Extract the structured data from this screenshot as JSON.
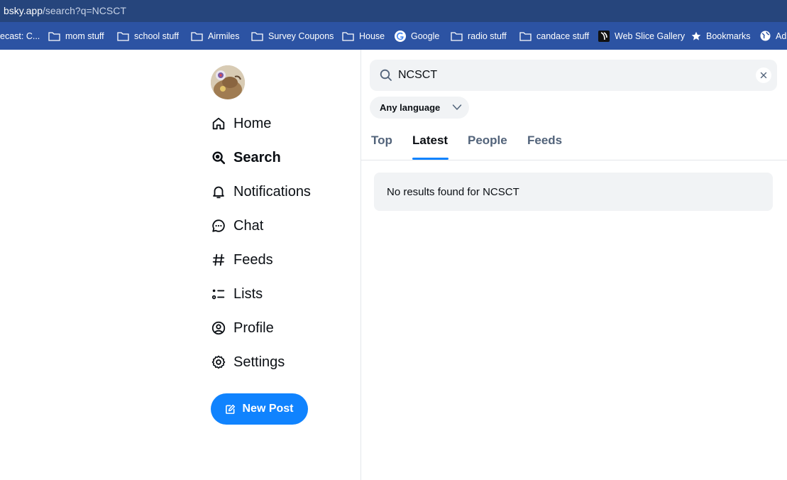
{
  "browser": {
    "url_host": "bsky.app",
    "url_path": "/search?q=NCSCT",
    "bookmarks": [
      {
        "label": "ecast: C...",
        "icon": "none"
      },
      {
        "label": "mom stuff",
        "icon": "folder-icon"
      },
      {
        "label": "school stuff",
        "icon": "folder-icon"
      },
      {
        "label": "Airmiles",
        "icon": "folder-icon"
      },
      {
        "label": "Survey Coupons",
        "icon": "folder-icon"
      },
      {
        "label": "House",
        "icon": "folder-icon"
      },
      {
        "label": "Google",
        "icon": "google-icon"
      },
      {
        "label": "radio stuff",
        "icon": "folder-icon"
      },
      {
        "label": "candace stuff",
        "icon": "folder-icon"
      },
      {
        "label": "Web Slice Gallery",
        "icon": "web-slice-icon"
      },
      {
        "label": "Bookmarks",
        "icon": "star-icon"
      },
      {
        "label": "Ad",
        "icon": "globe-icon"
      }
    ]
  },
  "nav": {
    "items": [
      {
        "label": "Home",
        "icon": "home-icon"
      },
      {
        "label": "Search",
        "icon": "search-icon",
        "active": true
      },
      {
        "label": "Notifications",
        "icon": "bell-icon"
      },
      {
        "label": "Chat",
        "icon": "chat-icon"
      },
      {
        "label": "Feeds",
        "icon": "hashtag-icon"
      },
      {
        "label": "Lists",
        "icon": "list-icon"
      },
      {
        "label": "Profile",
        "icon": "user-circle-icon"
      },
      {
        "label": "Settings",
        "icon": "gear-icon"
      }
    ],
    "new_post_label": "New Post"
  },
  "search": {
    "query": "NCSCT",
    "language": "Any language",
    "tabs": [
      {
        "label": "Top",
        "active": false
      },
      {
        "label": "Latest",
        "active": true
      },
      {
        "label": "People",
        "active": false
      },
      {
        "label": "Feeds",
        "active": false
      }
    ],
    "empty_message": "No results found for NCSCT"
  },
  "colors": {
    "accent": "#1083fe",
    "url_bar": "#26457c",
    "bookmarks_bar": "#2c53a3",
    "muted_text": "#52637a",
    "surface": "#f1f3f5"
  }
}
